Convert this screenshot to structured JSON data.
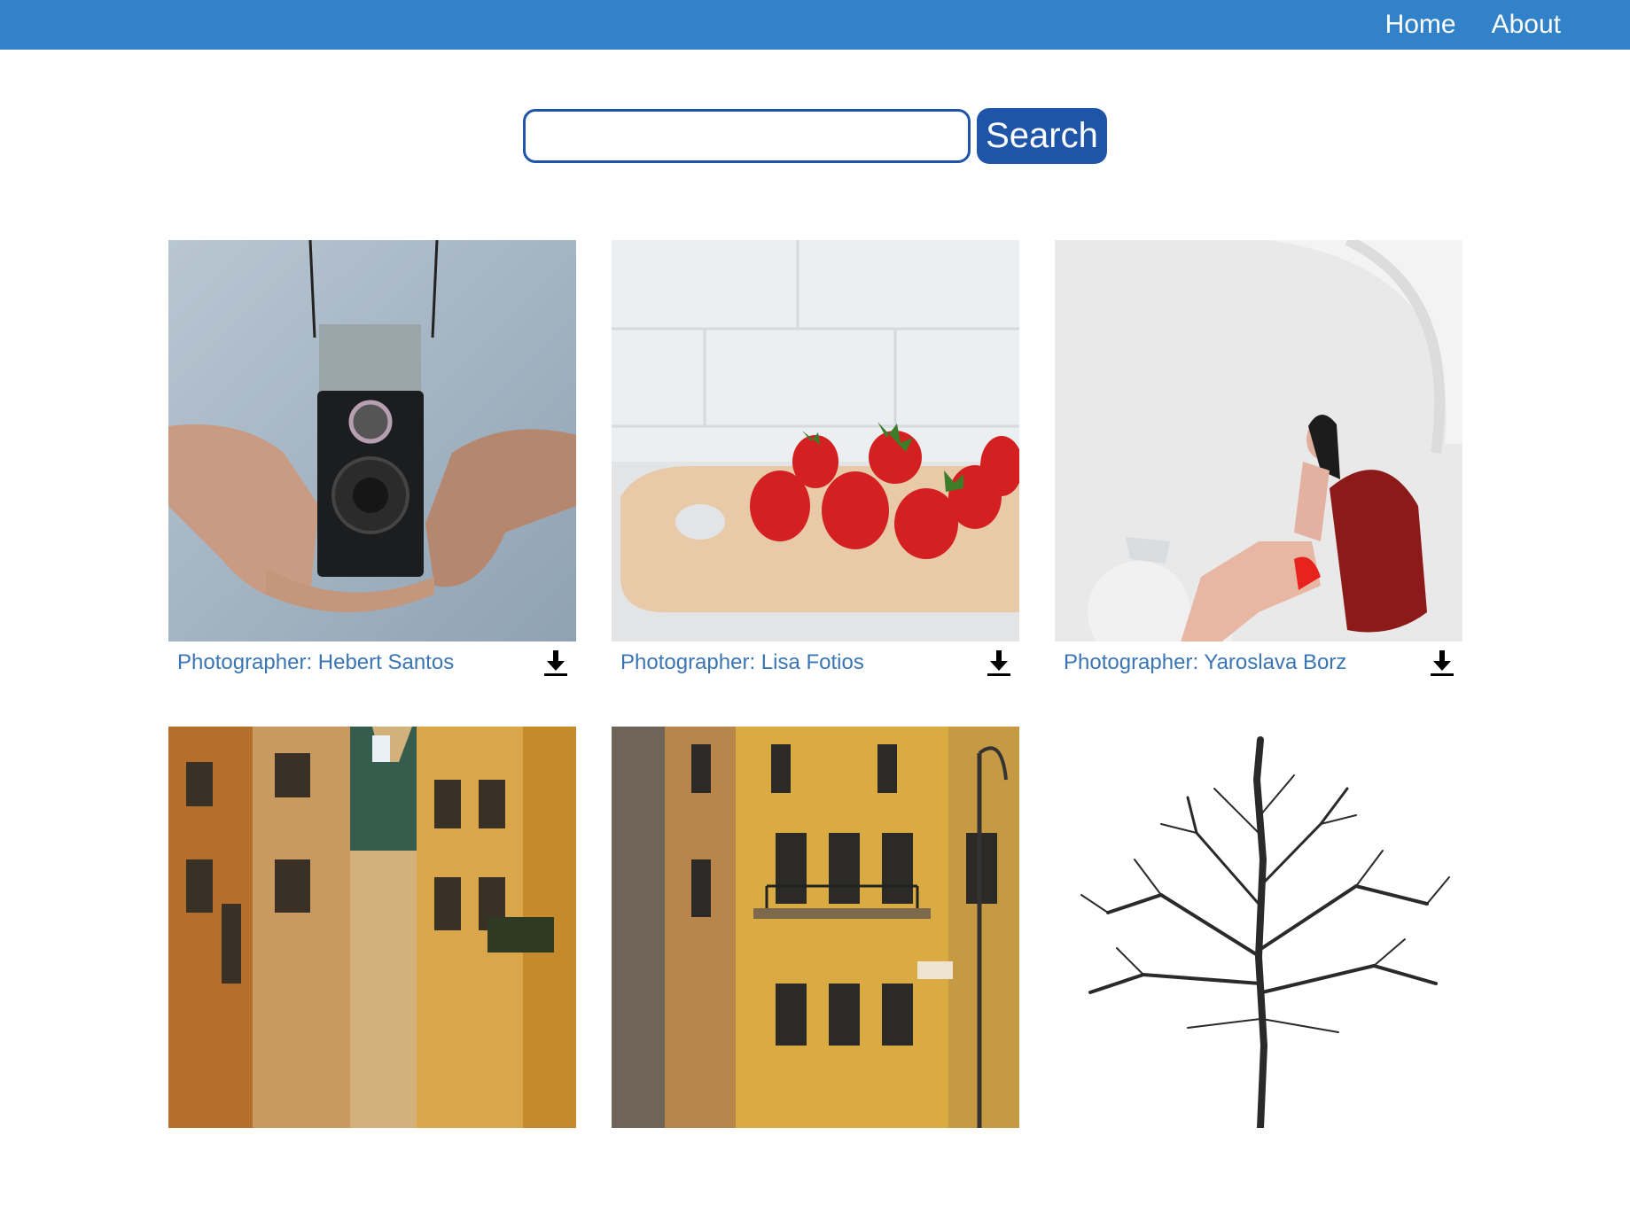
{
  "nav": {
    "home": "Home",
    "about": "About"
  },
  "search": {
    "value": "",
    "placeholder": "",
    "button_label": "Search"
  },
  "cards": [
    {
      "photographer": "Photographer: Hebert Santos"
    },
    {
      "photographer": "Photographer: Lisa Fotios"
    },
    {
      "photographer": "Photographer: Yaroslava Borz"
    },
    {
      "photographer": ""
    },
    {
      "photographer": ""
    },
    {
      "photographer": ""
    }
  ],
  "colors": {
    "navbar": "#3182c8",
    "button": "#1f55a8",
    "caption": "#3a75b3"
  }
}
